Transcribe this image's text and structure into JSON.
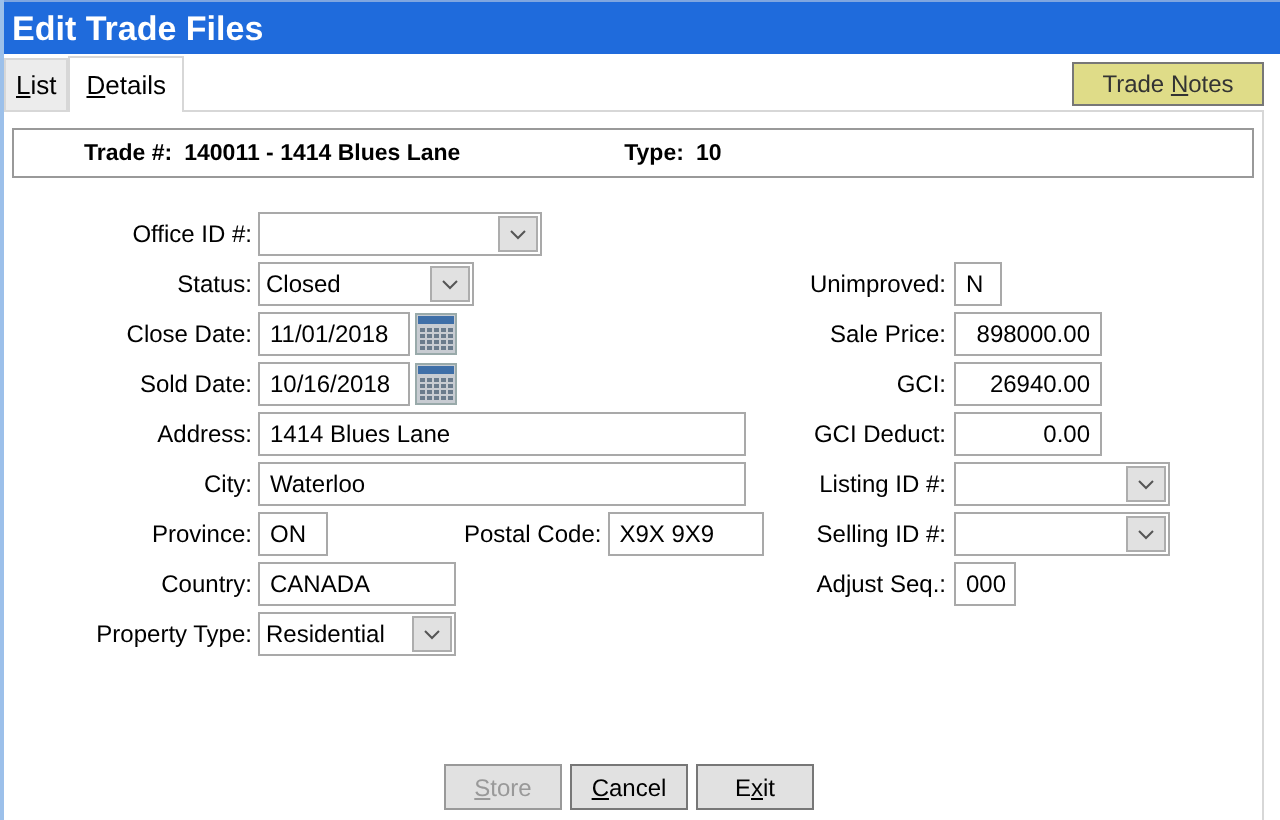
{
  "window": {
    "title": "Edit Trade Files"
  },
  "tabs": [
    {
      "label": {
        "key": "L",
        "after": "ist"
      },
      "selected": false
    },
    {
      "label": {
        "key": "D",
        "after": "etails"
      },
      "selected": true
    }
  ],
  "notes_button": {
    "label": {
      "before": "Trade ",
      "key": "N",
      "after": "otes"
    }
  },
  "header": {
    "trade_label": "Trade #:",
    "trade_value": "140011 - 1414 Blues Lane",
    "type_label": "Type:",
    "type_value": "10"
  },
  "left_fields": [
    {
      "label": "Office ID #:",
      "kind": "select"
    },
    {
      "label": "Status:",
      "kind": "select",
      "value": "Closed"
    },
    {
      "label": "Close Date:",
      "kind": "date",
      "value": "11/01/2018"
    },
    {
      "label": "Sold Date:",
      "kind": "date",
      "value": "10/16/2018"
    },
    {
      "label": "Address:",
      "kind": "text",
      "value": "1414 Blues Lane"
    },
    {
      "label": "City:",
      "kind": "text",
      "value": "Waterloo"
    },
    {
      "label": "Province:",
      "kind": "text",
      "value": "ON",
      "extra": {
        "label": "Postal Code:",
        "value": "X9X 9X9"
      }
    },
    {
      "label": "Country:",
      "kind": "text",
      "value": "CANADA"
    },
    {
      "label": "Property Type:",
      "kind": "select",
      "value": "Residential"
    }
  ],
  "right_fields": [
    {
      "label": "Unimproved:",
      "kind": "text",
      "value": "N"
    },
    {
      "label": "Sale Price:",
      "kind": "number",
      "value": "898000.00"
    },
    {
      "label": "GCI:",
      "kind": "number",
      "value": "26940.00"
    },
    {
      "label": "GCI Deduct:",
      "kind": "number",
      "value": "0.00"
    },
    {
      "label": "Listing ID #:",
      "kind": "select"
    },
    {
      "label": "Selling ID #:",
      "kind": "select"
    },
    {
      "label": "Adjust Seq.:",
      "kind": "text",
      "value": "000"
    }
  ],
  "buttons": [
    {
      "label": {
        "key": "S",
        "after": "tore"
      },
      "disabled": true
    },
    {
      "label": {
        "key": "C",
        "after": "ancel"
      },
      "disabled": false
    },
    {
      "label": {
        "before": "E",
        "key": "x",
        "after": "it"
      },
      "disabled": false
    }
  ]
}
